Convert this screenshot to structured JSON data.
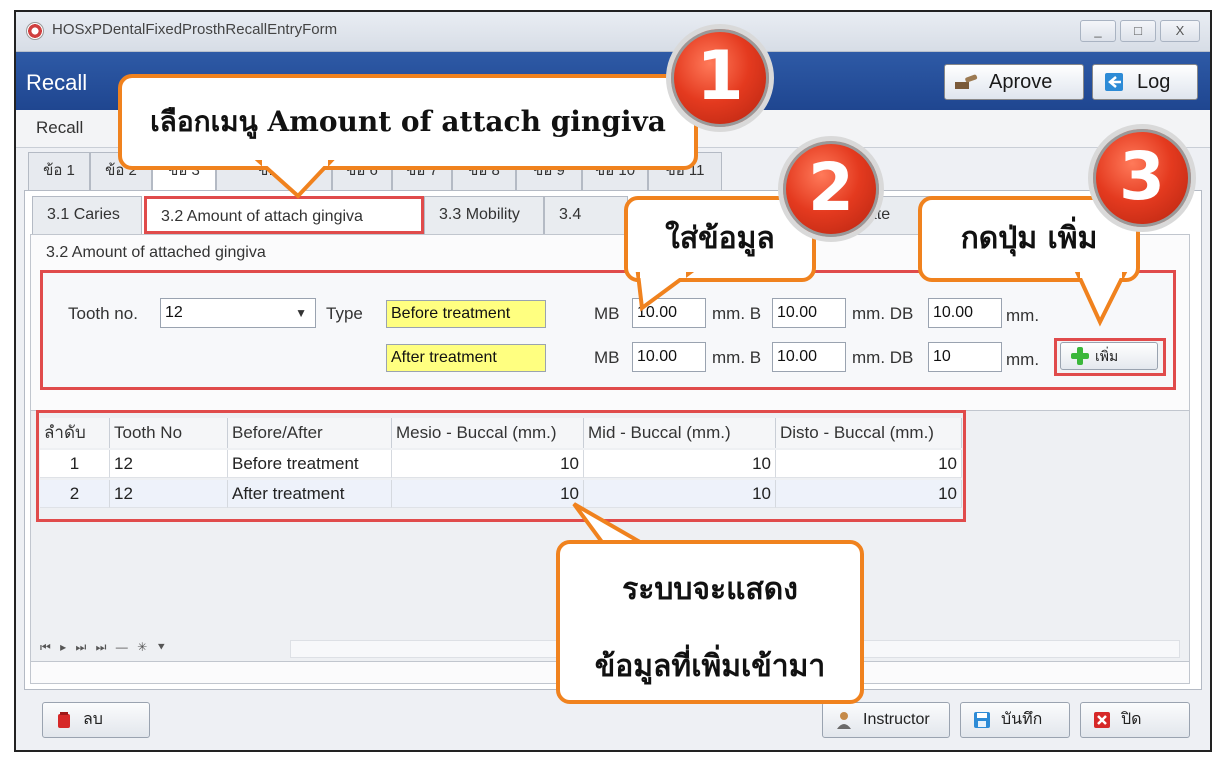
{
  "window": {
    "title": "HOSxPDentalFixedProsthRecallEntryForm",
    "controls": [
      "_",
      "□",
      "X"
    ]
  },
  "header": {
    "title": "Recall",
    "approve_label": "Aprove",
    "log_label": "Log"
  },
  "menu": {
    "recall": "Recall"
  },
  "tabs_level1": [
    "ข้อ 1",
    "ข้อ 2",
    "ข้อ 3",
    "ข้อ 5",
    "ข้อ 6",
    "ข้อ 7",
    "ข้อ 8",
    "ข้อ 9",
    "ข้อ 10",
    "ข้อ 11"
  ],
  "tabs_level2": [
    "3.1 Caries",
    "3.2 Amount of attach gingiva",
    "3.3 Mobility",
    "3.4 Sulc",
    "c state"
  ],
  "section_title": "3.2 Amount of attached gingiva",
  "form": {
    "tooth_label": "Tooth no.",
    "tooth_value": "12",
    "type_label": "Type",
    "rows": [
      {
        "type": "Before treatment",
        "mb": "10.00",
        "b": "10.00",
        "db": "10.00"
      },
      {
        "type": "After treatment",
        "mb": "10.00",
        "b": "10.00",
        "db": "10"
      }
    ],
    "mb_label": "MB",
    "mm_b_label": "mm. B",
    "mm_db_label": "mm. DB",
    "mm_label": "mm.",
    "add_button": "เพิ่ม"
  },
  "table": {
    "columns": [
      "ลำดับ",
      "Tooth No",
      "Before/After",
      "Mesio - Buccal (mm.)",
      "Mid - Buccal (mm.)",
      "Disto - Buccal (mm.)"
    ],
    "rows": [
      [
        "1",
        "12",
        "Before treatment",
        "10",
        "10",
        "10"
      ],
      [
        "2",
        "12",
        "After treatment",
        "10",
        "10",
        "10"
      ]
    ],
    "navigator": "⏮ ▸ ⏭ ⏭ — ✳ ⯆"
  },
  "footer": {
    "delete": "ลบ",
    "instructor": "Instructor",
    "save": "บันทึก",
    "close": "ปิด"
  },
  "callouts": {
    "c1_text": "เลือกเมนู Amount of attach gingiva",
    "c2_text": "ใส่ข้อมูล",
    "c3_text": "กดปุ่ม เพิ่ม",
    "c4_line1": "ระบบจะแสดง",
    "c4_line2": "ข้อมูลที่เพิ่มเข้ามา",
    "n1": "1",
    "n2": "2",
    "n3": "3"
  },
  "colors": {
    "header": "#2e5aa6",
    "highlight": "#e04b4b",
    "callout_border": "#f0821e",
    "yellow": "#ffff80"
  }
}
